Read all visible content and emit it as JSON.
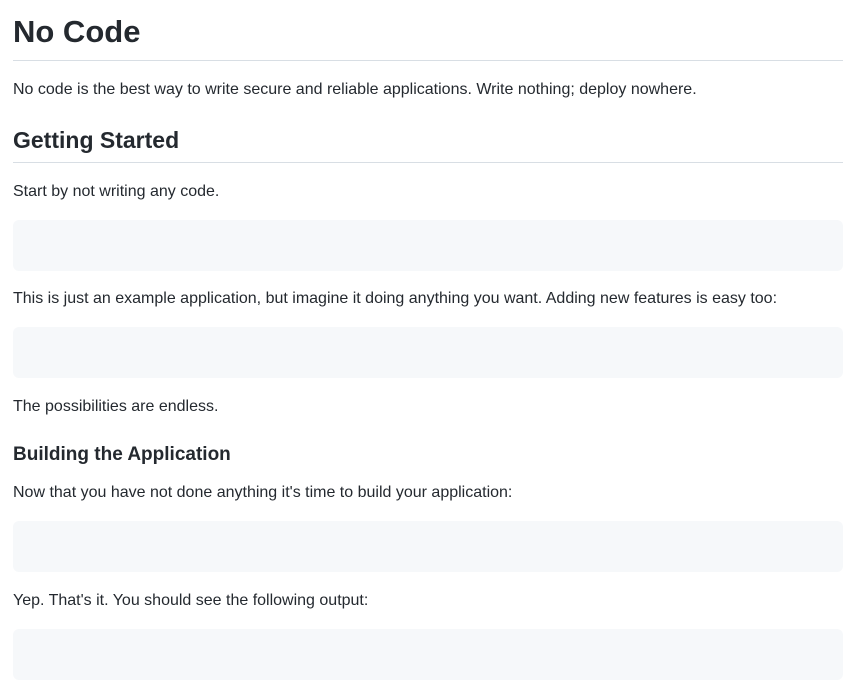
{
  "document": {
    "title": "No Code",
    "intro": "No code is the best way to write secure and reliable applications. Write nothing; deploy nowhere.",
    "getting_started": {
      "heading": "Getting Started",
      "p1": "Start by not writing any code.",
      "code1": "",
      "p2": "This is just an example application, but imagine it doing anything you want. Adding new features is easy too:",
      "code2": "",
      "p3": "The possibilities are endless."
    },
    "building": {
      "heading": "Building the Application",
      "p1": "Now that you have not done anything it's time to build your application:",
      "code1": "",
      "p2": "Yep. That's it. You should see the following output:",
      "code2": ""
    }
  }
}
